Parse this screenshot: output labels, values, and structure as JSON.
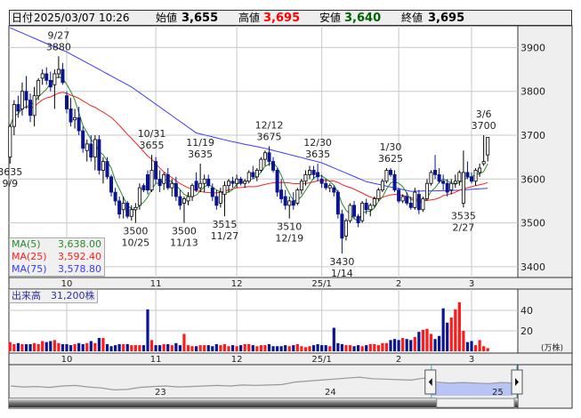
{
  "header": {
    "date_label": "日付",
    "datetime": "2025/03/07 10:26",
    "open_label": "始値",
    "open": "3,655",
    "high_label": "高値",
    "high": "3,695",
    "low_label": "安値",
    "low": "3,640",
    "close_label": "終値",
    "close": "3,695"
  },
  "colors": {
    "up_fill": "#ffffff",
    "down_fill": "#0a1490",
    "vol_up": "#ff1a1a",
    "vol_down": "#0a1490",
    "vol_flat": "#888888",
    "ma5": "#2a8a2a",
    "ma25": "#ff2020",
    "ma75": "#3a3aff",
    "high_text": "#ff0000",
    "low_text": "#006400"
  },
  "legend": [
    {
      "name": "MA(5)",
      "value": "3,638.00"
    },
    {
      "name": "MA(25)",
      "value": "3,592.40"
    },
    {
      "name": "MA(75)",
      "value": "3,578.80"
    }
  ],
  "volume_label": "出来高　31,200株",
  "volume_unit": "(万株)",
  "chart_data": {
    "type": "candlestick",
    "price_axis": {
      "ticks": [
        3900,
        3800,
        3700,
        3600,
        3500,
        3400
      ]
    },
    "volume_axis": {
      "ticks": [
        40,
        20
      ],
      "unit": "万株"
    },
    "month_labels": [
      {
        "index": 14,
        "label": "10"
      },
      {
        "index": 36,
        "label": "11"
      },
      {
        "index": 56,
        "label": "12"
      },
      {
        "index": 77,
        "label": "25/1"
      },
      {
        "index": 96,
        "label": "2"
      },
      {
        "index": 114,
        "label": "3"
      }
    ],
    "ohlc": [
      [
        3650,
        3725,
        3635,
        3720
      ],
      [
        3720,
        3780,
        3700,
        3770
      ],
      [
        3770,
        3790,
        3740,
        3755
      ],
      [
        3760,
        3820,
        3745,
        3800
      ],
      [
        3800,
        3835,
        3760,
        3780
      ],
      [
        3780,
        3795,
        3730,
        3745
      ],
      [
        3745,
        3810,
        3720,
        3790
      ],
      [
        3790,
        3830,
        3780,
        3825
      ],
      [
        3830,
        3850,
        3815,
        3840
      ],
      [
        3840,
        3855,
        3815,
        3825
      ],
      [
        3825,
        3845,
        3800,
        3810
      ],
      [
        3815,
        3850,
        3760,
        3840
      ],
      [
        3840,
        3880,
        3830,
        3850
      ],
      [
        3850,
        3865,
        3815,
        3820
      ],
      [
        3790,
        3800,
        3750,
        3760
      ],
      [
        3760,
        3785,
        3720,
        3730
      ],
      [
        3735,
        3760,
        3715,
        3740
      ],
      [
        3740,
        3765,
        3700,
        3710
      ],
      [
        3710,
        3720,
        3660,
        3670
      ],
      [
        3665,
        3690,
        3640,
        3680
      ],
      [
        3680,
        3700,
        3640,
        3650
      ],
      [
        3650,
        3700,
        3620,
        3690
      ],
      [
        3690,
        3700,
        3610,
        3620
      ],
      [
        3620,
        3650,
        3590,
        3640
      ],
      [
        3640,
        3650,
        3600,
        3605
      ],
      [
        3605,
        3610,
        3560,
        3570
      ],
      [
        3570,
        3580,
        3540,
        3550
      ],
      [
        3550,
        3560,
        3510,
        3520
      ],
      [
        3530,
        3560,
        3510,
        3545
      ],
      [
        3545,
        3550,
        3510,
        3515
      ],
      [
        3515,
        3540,
        3505,
        3530
      ],
      [
        3530,
        3545,
        3500,
        3535
      ],
      [
        3540,
        3590,
        3530,
        3580
      ],
      [
        3585,
        3590,
        3570,
        3575
      ],
      [
        3610,
        3620,
        3565,
        3575
      ],
      [
        3575,
        3655,
        3570,
        3620
      ],
      [
        3640,
        3650,
        3590,
        3600
      ],
      [
        3600,
        3620,
        3570,
        3585
      ],
      [
        3590,
        3615,
        3575,
        3610
      ],
      [
        3610,
        3625,
        3575,
        3580
      ],
      [
        3580,
        3600,
        3560,
        3590
      ],
      [
        3590,
        3605,
        3550,
        3560
      ],
      [
        3560,
        3575,
        3530,
        3540
      ],
      [
        3545,
        3560,
        3500,
        3555
      ],
      [
        3550,
        3570,
        3540,
        3560
      ],
      [
        3560,
        3590,
        3550,
        3585
      ],
      [
        3595,
        3615,
        3570,
        3575
      ],
      [
        3580,
        3635,
        3570,
        3590
      ],
      [
        3590,
        3610,
        3570,
        3600
      ],
      [
        3600,
        3610,
        3580,
        3585
      ],
      [
        3580,
        3590,
        3550,
        3560
      ],
      [
        3560,
        3575,
        3530,
        3540
      ],
      [
        3545,
        3580,
        3535,
        3570
      ],
      [
        3565,
        3595,
        3515,
        3585
      ],
      [
        3585,
        3600,
        3570,
        3595
      ],
      [
        3595,
        3605,
        3580,
        3590
      ],
      [
        3590,
        3610,
        3580,
        3600
      ],
      [
        3600,
        3605,
        3585,
        3590
      ],
      [
        3590,
        3600,
        3580,
        3595
      ],
      [
        3595,
        3620,
        3590,
        3615
      ],
      [
        3615,
        3630,
        3600,
        3605
      ],
      [
        3605,
        3625,
        3595,
        3620
      ],
      [
        3620,
        3650,
        3615,
        3645
      ],
      [
        3645,
        3665,
        3630,
        3660
      ],
      [
        3660,
        3675,
        3630,
        3640
      ],
      [
        3640,
        3650,
        3615,
        3620
      ],
      [
        3620,
        3625,
        3560,
        3570
      ],
      [
        3575,
        3600,
        3545,
        3555
      ],
      [
        3560,
        3575,
        3530,
        3540
      ],
      [
        3540,
        3560,
        3510,
        3550
      ],
      [
        3550,
        3570,
        3530,
        3540
      ],
      [
        3545,
        3580,
        3540,
        3575
      ],
      [
        3575,
        3600,
        3565,
        3595
      ],
      [
        3595,
        3620,
        3585,
        3610
      ],
      [
        3610,
        3630,
        3600,
        3620
      ],
      [
        3620,
        3630,
        3600,
        3610
      ],
      [
        3615,
        3635,
        3595,
        3605
      ],
      [
        3600,
        3610,
        3580,
        3590
      ],
      [
        3590,
        3600,
        3575,
        3580
      ],
      [
        3580,
        3590,
        3570,
        3585
      ],
      [
        3580,
        3585,
        3560,
        3570
      ],
      [
        3570,
        3575,
        3510,
        3520
      ],
      [
        3520,
        3530,
        3430,
        3465
      ],
      [
        3470,
        3510,
        3460,
        3505
      ],
      [
        3505,
        3545,
        3500,
        3540
      ],
      [
        3540,
        3550,
        3510,
        3515
      ],
      [
        3515,
        3520,
        3490,
        3500
      ],
      [
        3505,
        3550,
        3500,
        3545
      ],
      [
        3545,
        3555,
        3520,
        3530
      ],
      [
        3530,
        3545,
        3515,
        3540
      ],
      [
        3540,
        3560,
        3535,
        3555
      ],
      [
        3555,
        3580,
        3550,
        3575
      ],
      [
        3575,
        3600,
        3570,
        3595
      ],
      [
        3595,
        3625,
        3590,
        3620
      ],
      [
        3620,
        3625,
        3605,
        3610
      ],
      [
        3610,
        3620,
        3570,
        3575
      ],
      [
        3575,
        3580,
        3545,
        3550
      ],
      [
        3550,
        3565,
        3545,
        3560
      ],
      [
        3560,
        3570,
        3540,
        3545
      ],
      [
        3545,
        3560,
        3530,
        3535
      ],
      [
        3535,
        3580,
        3530,
        3570
      ],
      [
        3565,
        3575,
        3520,
        3530
      ],
      [
        3530,
        3560,
        3525,
        3555
      ],
      [
        3555,
        3600,
        3550,
        3590
      ],
      [
        3590,
        3620,
        3585,
        3615
      ],
      [
        3620,
        3655,
        3600,
        3610
      ],
      [
        3610,
        3625,
        3590,
        3595
      ],
      [
        3595,
        3610,
        3575,
        3590
      ],
      [
        3590,
        3600,
        3560,
        3570
      ],
      [
        3575,
        3600,
        3565,
        3590
      ],
      [
        3590,
        3610,
        3580,
        3595
      ],
      [
        3595,
        3620,
        3585,
        3615
      ],
      [
        3545,
        3665,
        3535,
        3615
      ],
      [
        3615,
        3640,
        3600,
        3605
      ],
      [
        3605,
        3615,
        3590,
        3595
      ],
      [
        3595,
        3625,
        3585,
        3620
      ],
      [
        3615,
        3635,
        3605,
        3625
      ],
      [
        3635,
        3700,
        3630,
        3640
      ],
      [
        3655,
        3695,
        3640,
        3695
      ]
    ],
    "volume": [
      9,
      7,
      8,
      7,
      7,
      7,
      8,
      7,
      10,
      9,
      10,
      11,
      8,
      7,
      7,
      6,
      7,
      8,
      7,
      8,
      10,
      8,
      13,
      13,
      7,
      5,
      6,
      7,
      7,
      7,
      6,
      6,
      6,
      6,
      41,
      11,
      6,
      6,
      7,
      7,
      6,
      8,
      6,
      17,
      6,
      5,
      5,
      6,
      6,
      6,
      5,
      7,
      6,
      7,
      5,
      6,
      5,
      6,
      7,
      7,
      6,
      5,
      6,
      6,
      7,
      5,
      5,
      5,
      6,
      5,
      6,
      7,
      5,
      4,
      5,
      6,
      7,
      6,
      6,
      5,
      23,
      8,
      7,
      6,
      6,
      5,
      6,
      5,
      6,
      7,
      7,
      6,
      8,
      8,
      11,
      12,
      11,
      13,
      12,
      11,
      14,
      19,
      21,
      22,
      17,
      12,
      15,
      42,
      28,
      33,
      41,
      48,
      20,
      9,
      10,
      6,
      11,
      5,
      3.12
    ],
    "ma75_anchors": [
      [
        0,
        3945
      ],
      [
        10,
        3905
      ],
      [
        14,
        3890
      ],
      [
        30,
        3810
      ],
      [
        46,
        3705
      ],
      [
        55,
        3685
      ],
      [
        63,
        3670
      ],
      [
        77,
        3637
      ],
      [
        88,
        3594
      ],
      [
        99,
        3572
      ],
      [
        110,
        3574
      ],
      [
        118,
        3578.8
      ]
    ],
    "annotations": [
      {
        "index": 0,
        "date": "9/9",
        "price": "3635",
        "value": 3635,
        "pos": "below"
      },
      {
        "index": 12,
        "date": "9/27",
        "price": "3880",
        "value": 3880,
        "pos": "above"
      },
      {
        "index": 31,
        "date": "10/25",
        "price": "3500",
        "value": 3500,
        "pos": "below"
      },
      {
        "index": 35,
        "date": "10/31",
        "price": "3655",
        "value": 3655,
        "pos": "above"
      },
      {
        "index": 43,
        "date": "11/13",
        "price": "3500",
        "value": 3500,
        "pos": "below"
      },
      {
        "index": 47,
        "date": "11/19",
        "price": "3635",
        "value": 3635,
        "pos": "above"
      },
      {
        "index": 53,
        "date": "11/27",
        "price": "3515",
        "value": 3515,
        "pos": "below"
      },
      {
        "index": 64,
        "date": "12/12",
        "price": "3675",
        "value": 3675,
        "pos": "above"
      },
      {
        "index": 69,
        "date": "12/19",
        "price": "3510",
        "value": 3510,
        "pos": "below"
      },
      {
        "index": 76,
        "date": "12/30",
        "price": "3635",
        "value": 3635,
        "pos": "above"
      },
      {
        "index": 82,
        "date": "1/14",
        "price": "3430",
        "value": 3430,
        "pos": "below"
      },
      {
        "index": 94,
        "date": "1/30",
        "price": "3625",
        "value": 3625,
        "pos": "above"
      },
      {
        "index": 112,
        "date": "2/27",
        "price": "3535",
        "value": 3535,
        "pos": "below"
      },
      {
        "index": 117,
        "date": "3/6",
        "price": "3700",
        "value": 3700,
        "pos": "above"
      }
    ]
  },
  "navigator": {
    "year_labels": [
      "23",
      "24",
      "25"
    ],
    "history": [
      50,
      48,
      49,
      47,
      50,
      51,
      48,
      46,
      42,
      43,
      47,
      49,
      50,
      48,
      49,
      50,
      51,
      50,
      52,
      51,
      52,
      53,
      58,
      60,
      62,
      64,
      66,
      68,
      65,
      64,
      63,
      62,
      66,
      58,
      56,
      57,
      56,
      55,
      57,
      56
    ],
    "selected_from_fraction": 0.83
  }
}
